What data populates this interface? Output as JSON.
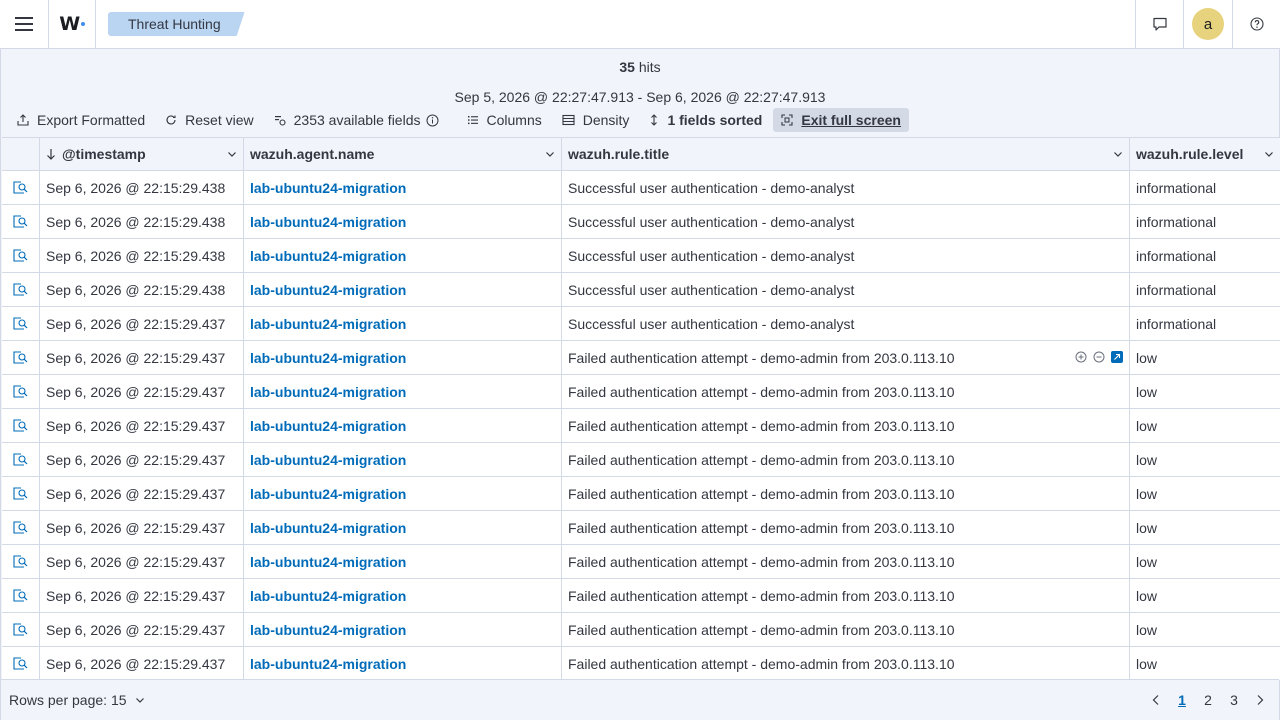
{
  "header": {
    "breadcrumb": "Threat Hunting",
    "user_initial": "a"
  },
  "summary": {
    "hits_count": "35",
    "hits_label": "hits",
    "time_range": "Sep 5, 2026 @ 22:27:47.913 - Sep 6, 2026 @ 22:27:47.913"
  },
  "toolbar": {
    "export": "Export Formatted",
    "reset": "Reset view",
    "fields": "2353 available fields",
    "columns": "Columns",
    "density": "Density",
    "sorted": "1 fields sorted",
    "exit_fullscreen": "Exit full screen"
  },
  "columns": [
    "@timestamp",
    "wazuh.agent.name",
    "wazuh.rule.title",
    "wazuh.rule.level"
  ],
  "rows": [
    {
      "timestamp": "Sep 6, 2026 @ 22:15:29.438",
      "agent": "lab-ubuntu24-migration",
      "title": "Successful user authentication - demo-analyst",
      "level": "informational"
    },
    {
      "timestamp": "Sep 6, 2026 @ 22:15:29.438",
      "agent": "lab-ubuntu24-migration",
      "title": "Successful user authentication - demo-analyst",
      "level": "informational"
    },
    {
      "timestamp": "Sep 6, 2026 @ 22:15:29.438",
      "agent": "lab-ubuntu24-migration",
      "title": "Successful user authentication - demo-analyst",
      "level": "informational"
    },
    {
      "timestamp": "Sep 6, 2026 @ 22:15:29.438",
      "agent": "lab-ubuntu24-migration",
      "title": "Successful user authentication - demo-analyst",
      "level": "informational"
    },
    {
      "timestamp": "Sep 6, 2026 @ 22:15:29.437",
      "agent": "lab-ubuntu24-migration",
      "title": "Successful user authentication - demo-analyst",
      "level": "informational"
    },
    {
      "timestamp": "Sep 6, 2026 @ 22:15:29.437",
      "agent": "lab-ubuntu24-migration",
      "title": "Failed authentication attempt - demo-admin from 203.0.113.10",
      "level": "low"
    },
    {
      "timestamp": "Sep 6, 2026 @ 22:15:29.437",
      "agent": "lab-ubuntu24-migration",
      "title": "Failed authentication attempt - demo-admin from 203.0.113.10",
      "level": "low"
    },
    {
      "timestamp": "Sep 6, 2026 @ 22:15:29.437",
      "agent": "lab-ubuntu24-migration",
      "title": "Failed authentication attempt - demo-admin from 203.0.113.10",
      "level": "low"
    },
    {
      "timestamp": "Sep 6, 2026 @ 22:15:29.437",
      "agent": "lab-ubuntu24-migration",
      "title": "Failed authentication attempt - demo-admin from 203.0.113.10",
      "level": "low"
    },
    {
      "timestamp": "Sep 6, 2026 @ 22:15:29.437",
      "agent": "lab-ubuntu24-migration",
      "title": "Failed authentication attempt - demo-admin from 203.0.113.10",
      "level": "low"
    },
    {
      "timestamp": "Sep 6, 2026 @ 22:15:29.437",
      "agent": "lab-ubuntu24-migration",
      "title": "Failed authentication attempt - demo-admin from 203.0.113.10",
      "level": "low"
    },
    {
      "timestamp": "Sep 6, 2026 @ 22:15:29.437",
      "agent": "lab-ubuntu24-migration",
      "title": "Failed authentication attempt - demo-admin from 203.0.113.10",
      "level": "low"
    },
    {
      "timestamp": "Sep 6, 2026 @ 22:15:29.437",
      "agent": "lab-ubuntu24-migration",
      "title": "Failed authentication attempt - demo-admin from 203.0.113.10",
      "level": "low"
    },
    {
      "timestamp": "Sep 6, 2026 @ 22:15:29.437",
      "agent": "lab-ubuntu24-migration",
      "title": "Failed authentication attempt - demo-admin from 203.0.113.10",
      "level": "low"
    },
    {
      "timestamp": "Sep 6, 2026 @ 22:15:29.437",
      "agent": "lab-ubuntu24-migration",
      "title": "Failed authentication attempt - demo-admin from 203.0.113.10",
      "level": "low"
    }
  ],
  "footer": {
    "rows_per_page": "Rows per page: 15",
    "pages": [
      "1",
      "2",
      "3"
    ],
    "current_page": "1"
  },
  "icons": {
    "menu": "hamburger-menu-icon",
    "chat": "chat-icon",
    "help": "help-icon",
    "row_expand": "inspect-document-icon",
    "sort": "sort-down-icon"
  },
  "colors": {
    "link": "#006bb8",
    "breadcrumb_bg": "#b9d5f2",
    "avatar_bg": "#e7d37e",
    "panel_bg": "#f1f4fa",
    "border": "#d3dae6"
  }
}
